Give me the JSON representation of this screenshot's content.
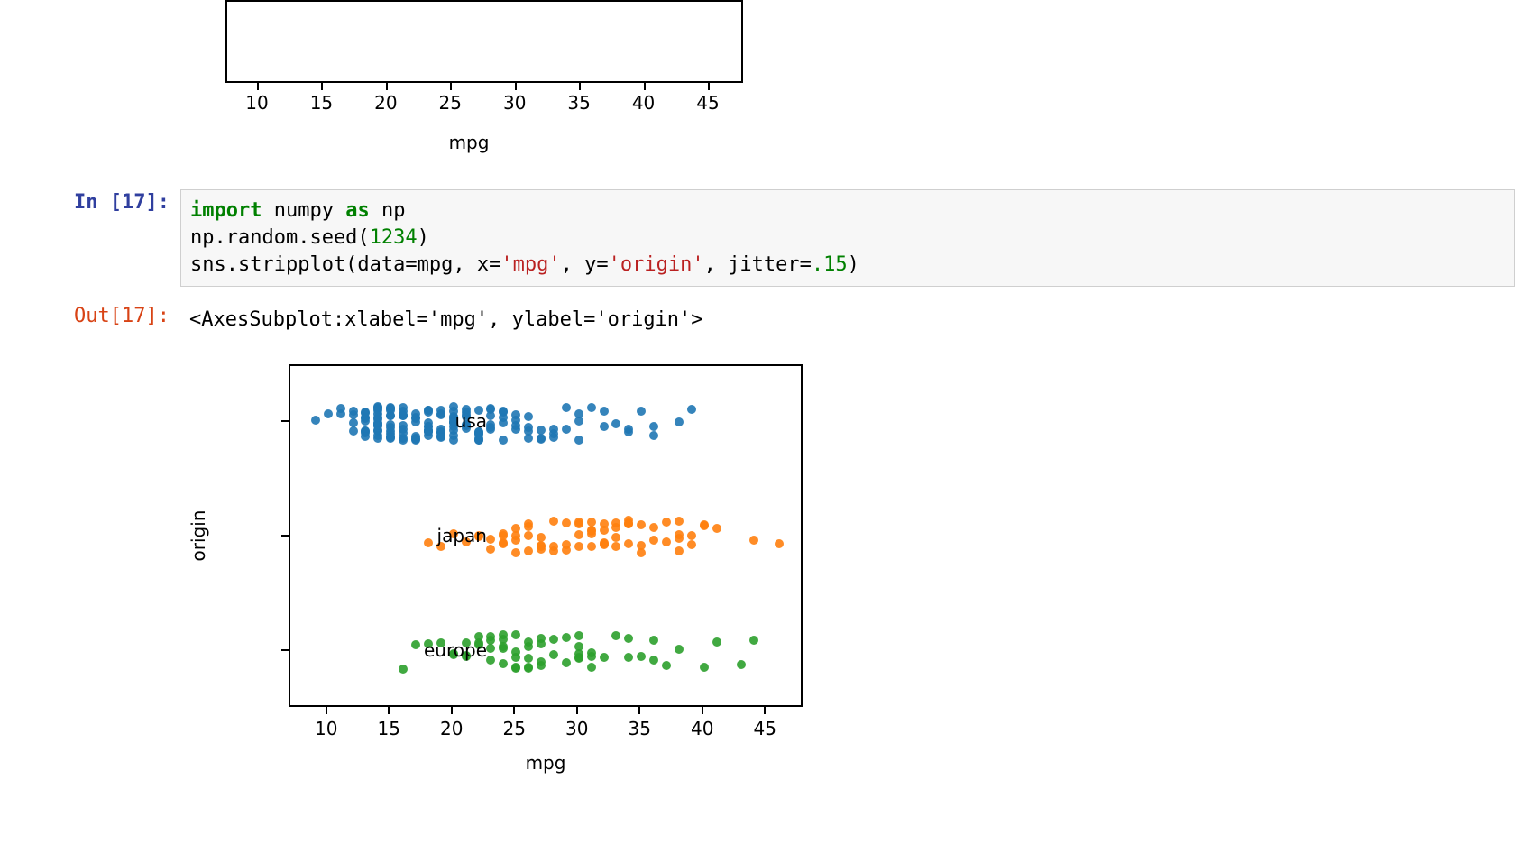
{
  "top_chart": {
    "xlabel": "mpg",
    "xticks": [
      10,
      15,
      20,
      25,
      30,
      35,
      40,
      45
    ]
  },
  "code_cell": {
    "in_prompt": "In [17]:",
    "out_prompt": "Out[17]:",
    "code_tokens": [
      {
        "t": "import",
        "c": "kw"
      },
      {
        "t": " numpy ",
        "c": ""
      },
      {
        "t": "as",
        "c": "kw"
      },
      {
        "t": " np\n",
        "c": ""
      },
      {
        "t": "np.random.seed(",
        "c": ""
      },
      {
        "t": "1234",
        "c": "num"
      },
      {
        "t": ")\n",
        "c": ""
      },
      {
        "t": "sns.stripplot(data",
        "c": ""
      },
      {
        "t": "=",
        "c": ""
      },
      {
        "t": "mpg, x",
        "c": ""
      },
      {
        "t": "=",
        "c": ""
      },
      {
        "t": "'mpg'",
        "c": "str"
      },
      {
        "t": ", y",
        "c": ""
      },
      {
        "t": "=",
        "c": ""
      },
      {
        "t": "'origin'",
        "c": "str"
      },
      {
        "t": ", jitter",
        "c": ""
      },
      {
        "t": "=",
        "c": ""
      },
      {
        "t": ".15",
        "c": "num"
      },
      {
        "t": ")",
        "c": ""
      }
    ],
    "output_repr": "<AxesSubplot:xlabel='mpg', ylabel='origin'>"
  },
  "chart_data": {
    "type": "scatter",
    "title": "",
    "xlabel": "mpg",
    "ylabel": "origin",
    "xlim": [
      7,
      48
    ],
    "xticks": [
      10,
      15,
      20,
      25,
      30,
      35,
      40,
      45
    ],
    "categories": [
      "usa",
      "japan",
      "europe"
    ],
    "series": [
      {
        "name": "usa",
        "color": "#1f77b4",
        "x": [
          9,
          10,
          11,
          11,
          12,
          12,
          12,
          12,
          13,
          13,
          13,
          13,
          13,
          13,
          13,
          13,
          13,
          14,
          14,
          14,
          14,
          14,
          14,
          14,
          14,
          14,
          14,
          14,
          14,
          14,
          14,
          14,
          15,
          15,
          15,
          15,
          15,
          15,
          15,
          15,
          15,
          15,
          15,
          15,
          15,
          16,
          16,
          16,
          16,
          16,
          16,
          16,
          16,
          16,
          16,
          17,
          17,
          17,
          17,
          17,
          17,
          17,
          17,
          18,
          18,
          18,
          18,
          18,
          18,
          18,
          18,
          18,
          18,
          18,
          18,
          19,
          19,
          19,
          19,
          19,
          19,
          19,
          19,
          19,
          19,
          20,
          20,
          20,
          20,
          20,
          20,
          20,
          20,
          20,
          20,
          20,
          21,
          21,
          21,
          21,
          21,
          21,
          21,
          22,
          22,
          22,
          22,
          22,
          22,
          22,
          22,
          23,
          23,
          23,
          23,
          23,
          23,
          24,
          24,
          24,
          24,
          24,
          25,
          25,
          25,
          25,
          26,
          26,
          26,
          26,
          27,
          27,
          27,
          28,
          28,
          28,
          29,
          29,
          30,
          30,
          30,
          31,
          32,
          32,
          33,
          36,
          36,
          39,
          34,
          34,
          35,
          38,
          20,
          21
        ]
      },
      {
        "name": "japan",
        "color": "#ff7f0e",
        "x": [
          18,
          19,
          20,
          21,
          22,
          22,
          23,
          23,
          24,
          24,
          24,
          24,
          25,
          25,
          25,
          25,
          26,
          26,
          26,
          27,
          27,
          27,
          28,
          28,
          28,
          29,
          29,
          30,
          30,
          30,
          31,
          31,
          31,
          31,
          32,
          32,
          32,
          32,
          33,
          33,
          33,
          34,
          34,
          34,
          34,
          34,
          35,
          35,
          35,
          36,
          36,
          37,
          37,
          38,
          38,
          38,
          38,
          39,
          39,
          40,
          40,
          41,
          44,
          46,
          32,
          33,
          31,
          30,
          29,
          27,
          26
        ]
      },
      {
        "name": "europe",
        "color": "#2ca02c",
        "x": [
          16,
          17,
          18,
          19,
          20,
          21,
          21,
          22,
          22,
          23,
          23,
          23,
          24,
          24,
          24,
          24,
          25,
          25,
          25,
          25,
          26,
          26,
          26,
          26,
          26,
          27,
          27,
          27,
          28,
          28,
          29,
          29,
          30,
          30,
          30,
          30,
          31,
          31,
          31,
          32,
          33,
          34,
          34,
          35,
          36,
          36,
          37,
          38,
          40,
          41,
          43,
          44,
          24,
          25,
          27,
          30,
          23,
          22,
          21,
          20
        ]
      }
    ]
  }
}
